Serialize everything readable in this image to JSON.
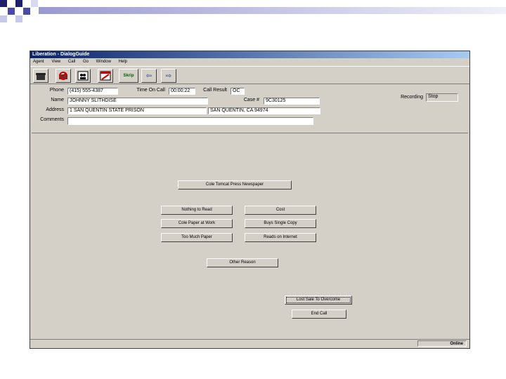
{
  "window": {
    "title": "Liberation - DialogGuide"
  },
  "menu": [
    "Agent",
    "View",
    "Call",
    "Go",
    "Window",
    "Help"
  ],
  "toolbar": {
    "script_label": "Skrip"
  },
  "form": {
    "phone_label": "Phone",
    "phone_value": "(415) 555-4387",
    "time_on_call_label": "Time On Call",
    "time_on_call_value": "00:00:22",
    "call_result_label": "Call Result",
    "call_result_value": "OC",
    "name_label": "Name",
    "name_value": "JOHNNY SLITHDISE",
    "case_label": "Case #",
    "case_value": "9C30125",
    "address_label": "Address",
    "address_value": "1 SAN QUENTIN STATE PRISON",
    "city_value": "SAN QUENTIN, CA 94974",
    "comments_label": "Comments",
    "comments_value": "",
    "recording_label": "Recording",
    "recording_value": "Stop"
  },
  "buttons": {
    "newspaper": "Cole Tomcat Press Newspaper",
    "nothing": "Nothing to Read",
    "cost": "Cost",
    "cole_work": "Cole Paper at Work",
    "buys_single": "Buys Single Copy",
    "too_much": "Too Much Paper",
    "reads_internet": "Reads on Internet",
    "other": "Other Reason",
    "no_sale": "Lost Sale To Overcome",
    "end_call": "End Call"
  },
  "status": {
    "online": "Online"
  }
}
